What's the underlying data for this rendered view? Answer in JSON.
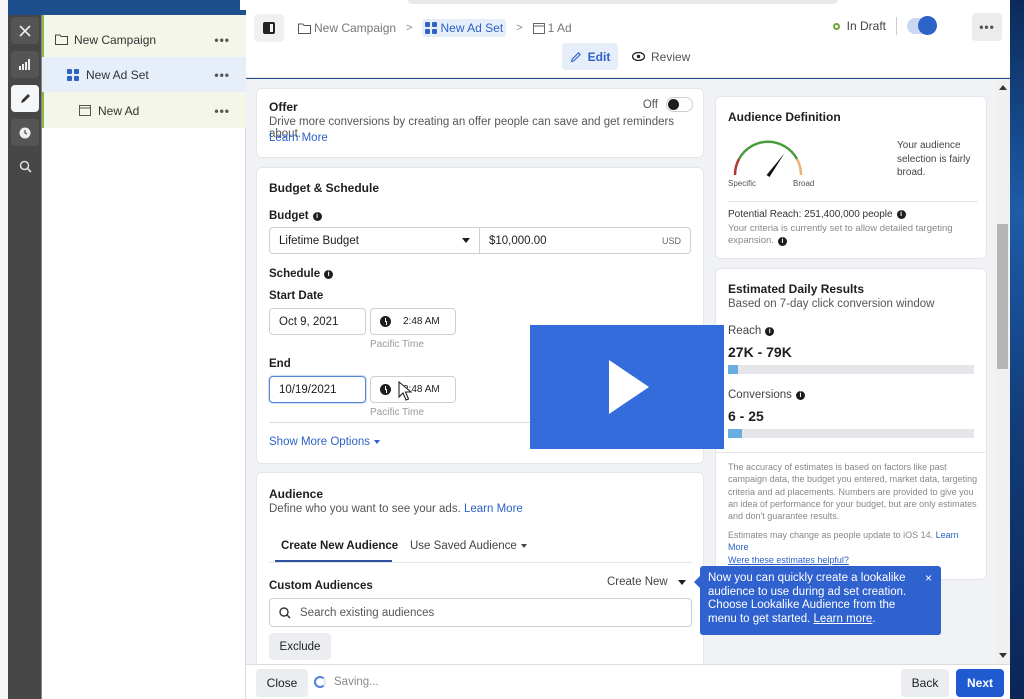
{
  "rail": {
    "items": [
      {
        "icon": "close-icon",
        "glyph": "✕"
      },
      {
        "icon": "bar-chart-icon",
        "glyph": "📊"
      },
      {
        "icon": "pencil-icon",
        "glyph": "✎"
      },
      {
        "icon": "clock-icon",
        "glyph": "🕑"
      },
      {
        "icon": "search-chart-icon",
        "glyph": "🔍"
      }
    ]
  },
  "tree": {
    "items": [
      {
        "label": "New Campaign",
        "icon": "folder-icon",
        "more": "•••"
      },
      {
        "label": "New Ad Set",
        "icon": "grid-icon",
        "more": "•••"
      },
      {
        "label": "New Ad",
        "icon": "ad-window-icon",
        "more": "•••"
      }
    ]
  },
  "header": {
    "breadcrumbs": [
      {
        "label": "New Campaign"
      },
      {
        "label": "New Ad Set"
      },
      {
        "label": "1 Ad"
      }
    ],
    "separator": ">",
    "status_label": "In Draft",
    "more_label": "•••",
    "tabs": [
      {
        "label": "Edit"
      },
      {
        "label": "Review"
      }
    ]
  },
  "offer": {
    "title": "Offer",
    "toggle_label": "Off",
    "description": "Drive more conversions by creating an offer people can save and get reminders about.",
    "learn_more": "Learn More"
  },
  "budget": {
    "title": "Budget & Schedule",
    "budget_label": "Budget",
    "budget_type": "Lifetime Budget",
    "amount": "$10,000.00",
    "currency": "USD",
    "schedule_label": "Schedule",
    "start_label": "Start Date",
    "start_date": "Oct 9, 2021",
    "start_time": "2:48 AM",
    "end_label": "End",
    "end_date": "10/19/2021",
    "end_time": "2:48 AM",
    "timezone": "Pacific Time",
    "show_more": "Show More Options"
  },
  "audience": {
    "title": "Audience",
    "description": "Define who you want to see your ads.",
    "learn_more": "Learn More",
    "tabs": [
      {
        "label": "Create New Audience"
      },
      {
        "label": "Use Saved Audience"
      }
    ],
    "custom_label": "Custom Audiences",
    "create_new": "Create New",
    "search_placeholder": "Search existing audiences",
    "exclude": "Exclude"
  },
  "audience_definition": {
    "title": "Audience Definition",
    "gauge_left": "Specific",
    "gauge_right": "Broad",
    "gauge_level": 0.7,
    "summary": "Your audience selection is fairly broad.",
    "potential_reach": "Potential Reach: 251,400,000 people",
    "expansion_note": "Your criteria is currently set to allow detailed targeting expansion."
  },
  "estimates": {
    "title": "Estimated Daily Results",
    "subtitle": "Based on 7-day click conversion window",
    "reach_label": "Reach",
    "reach_value": "27K - 79K",
    "reach_fill": 0.04,
    "conversions_label": "Conversions",
    "conversions_value": "6 - 25",
    "conversions_fill": 0.055,
    "disclaimer": "The accuracy of estimates is based on factors like past campaign data, the budget you entered, market data, targeting criteria and ad placements. Numbers are provided to give you an idea of performance for your budget, but are only estimates and don't guarantee results.",
    "ios_note": "Estimates may change as people update to iOS 14.",
    "ios_learn_more": "Learn More",
    "helpful": "Were these estimates helpful?"
  },
  "tooltip": {
    "text": "Now you can quickly create a lookalike audience to use during ad set creation. Choose Lookalike Audience from the menu to get started.",
    "link": "Learn more",
    "close": "×"
  },
  "footer": {
    "close": "Close",
    "saving": "Saving...",
    "back": "Back",
    "next": "Next"
  },
  "colors": {
    "accent": "#2d62c7",
    "primary_button": "#1f5ad1",
    "tooltip": "#3062cf",
    "draft_dot": "#6ba53b",
    "play_overlay": "#346ddb"
  }
}
